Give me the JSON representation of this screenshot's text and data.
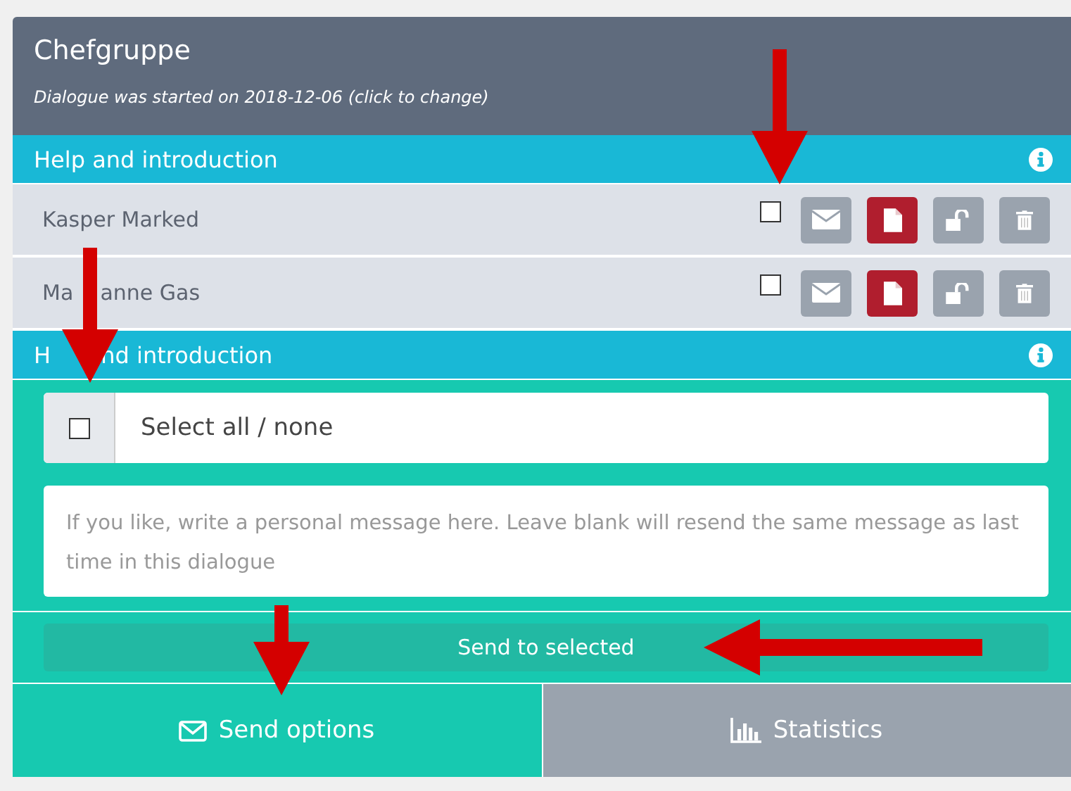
{
  "header": {
    "title": "Chefgruppe",
    "subtitle": "Dialogue was started on 2018-12-06 (click to change)"
  },
  "sections": [
    {
      "title": "Help and introduction",
      "recipients": [
        {
          "name": "Kasper Marked",
          "checked": false
        },
        {
          "name": "Ma    anne Gas",
          "checked": false
        }
      ]
    },
    {
      "title": "H       nd introduction"
    }
  ],
  "select_all": {
    "label": "Select all / none",
    "checked": false
  },
  "message": {
    "placeholder": "If you like, write a personal message here. Leave blank will resend the same message as last time in this dialogue"
  },
  "send_button": "Send to selected",
  "tabs": [
    {
      "label": "Send options",
      "selected": true
    },
    {
      "label": "Statistics",
      "selected": false
    }
  ],
  "annotations": [
    {
      "kind": "arrow"
    },
    {
      "kind": "arrow"
    },
    {
      "kind": "arrow"
    },
    {
      "kind": "arrow"
    }
  ]
}
